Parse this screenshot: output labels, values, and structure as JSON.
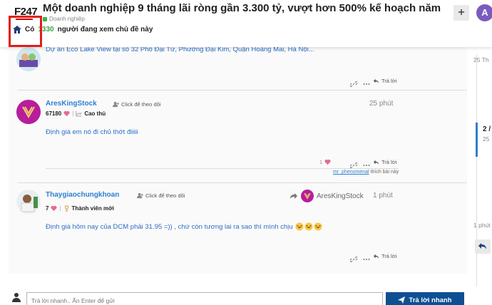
{
  "header": {
    "logo": "F247",
    "title": "Một doanh nghiệp 9 tháng lãi ròng gần 3.300 tỷ, vượt hơn 500% kế hoạch năm",
    "category": "Doanh nghiệp",
    "plus_label": "+",
    "avatar_letter": "A"
  },
  "viewers": {
    "prefix": "Có",
    "count": "1330",
    "suffix": "người đang xem chủ đề này"
  },
  "posts": [
    {
      "body": "Dự án Eco Lake View tại số 32 Phố Đại Từ, Phường Đại Kim, Quận Hoàng Mai, Hà Nội...",
      "reply_label": "Trả lời"
    },
    {
      "username": "AresKingStock",
      "follow_label": "Click để theo dõi",
      "points": "67180",
      "rank": "Cao thủ",
      "time": "25 phút",
      "body": "Định giá em nó đi chủ thớt điiiii",
      "like_count": "1",
      "reply_label": "Trả lời",
      "liked_by_user": "mr_phenomenal",
      "liked_by_suffix": "thích bài này"
    },
    {
      "username": "Thaygiaochungkhoan",
      "follow_label": "Click để theo dõi",
      "points": "7",
      "rank": "Thành viên mới",
      "reply_to": "AresKingStock",
      "time": "1 phút",
      "body": "Định giá hôm nay của DCM phải 31.95 =)) , chứ còn tương lai ra sao thì mình chịu",
      "reply_label": "Trả lời"
    }
  ],
  "timeline": {
    "top_date": "25 Th",
    "position": "2 /",
    "position_sub": "25",
    "bottom_date": "1 phút"
  },
  "composer": {
    "placeholder": "Trả lời nhanh.. Ấn Enter để gửi",
    "button_label": "Trả lời nhanh"
  },
  "colors": {
    "accent_blue": "#2d7fd1",
    "button_navy": "#0e4f93",
    "viewer_green": "#3aa34a",
    "highlight_red": "#e31b1b"
  }
}
